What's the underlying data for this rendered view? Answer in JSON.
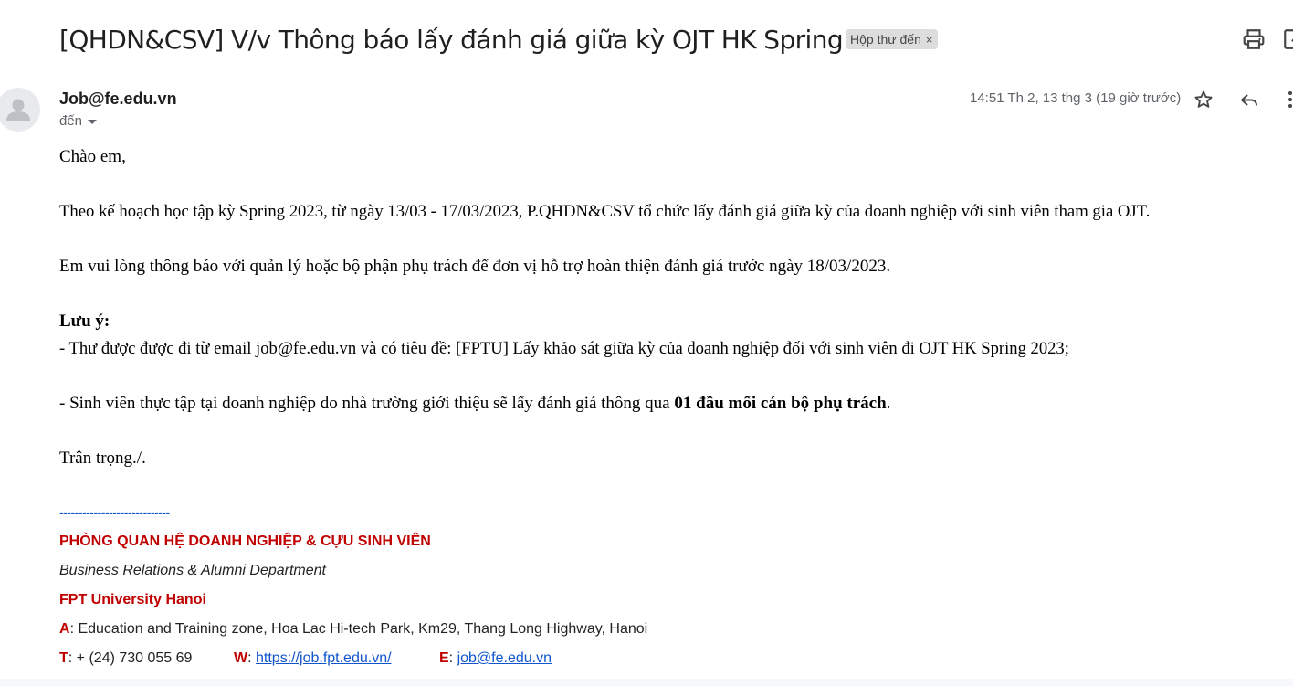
{
  "email": {
    "subject": "[QHDN&CSV] V/v Thông báo lấy đánh giá giữa kỳ OJT HK Spring 2023",
    "label": "Hộp thư đến",
    "label_close": "×",
    "sender": "Job@fe.edu.vn",
    "recipient_label": "đến",
    "timestamp": "14:51 Th 2, 13 thg 3 (19 giờ trước)"
  },
  "body": {
    "greeting": "Chào em,",
    "para1": "Theo kế hoạch học tập kỳ Spring 2023, từ ngày 13/03 - 17/03/2023, P.QHDN&CSV tổ chức lấy đánh giá giữa kỳ của doanh nghiệp với sinh viên tham gia OJT.",
    "para2": "Em vui lòng thông báo với quản lý hoặc bộ phận phụ trách để đơn vị hỗ trợ hoàn thiện đánh giá trước ngày 18/03/2023.",
    "note_title": "Lưu ý:",
    "note1": "- Thư được được đi từ email job@fe.edu.vn và có tiêu đề: [FPTU] Lấy khảo sát giữa kỳ của doanh nghiệp đối với sinh viên đi OJT HK Spring 2023;",
    "note2_prefix": "- Sinh viên thực tập tại doanh nghiệp do nhà trường giới thiệu sẽ lấy đánh giá thông qua ",
    "note2_bold": "01 đầu mối cán bộ phụ trách",
    "note2_suffix": ".",
    "closing": "Trân trọng./."
  },
  "signature": {
    "divider": "-----------------------------",
    "dept_vn": "PHÒNG QUAN HỆ DOANH NGHIỆP & CỰU SINH VIÊN",
    "dept_en": "Business Relations & Alumni Department",
    "university": "FPT University Hanoi",
    "address_label": "A",
    "address": ": Education and Training zone, Hoa Lac Hi-tech Park, Km29, Thang Long Highway, Hanoi",
    "phone_label": "T",
    "phone": ": + (24) 730 055 69",
    "web_label": "W",
    "web_sep": ": ",
    "web": "https://job.fpt.edu.vn/",
    "email_label": "E",
    "email_sep": ": ",
    "email": "job@fe.edu.vn"
  },
  "icons": {
    "print": "print-icon",
    "open_new_window": "open-in-new-window-icon",
    "star": "star-icon",
    "reply": "reply-icon",
    "more": "more-vert-icon",
    "avatar": "person-icon"
  },
  "colors": {
    "accent_red": "#c00000",
    "link": "#1155cc",
    "chip_bg": "#dddddd"
  }
}
